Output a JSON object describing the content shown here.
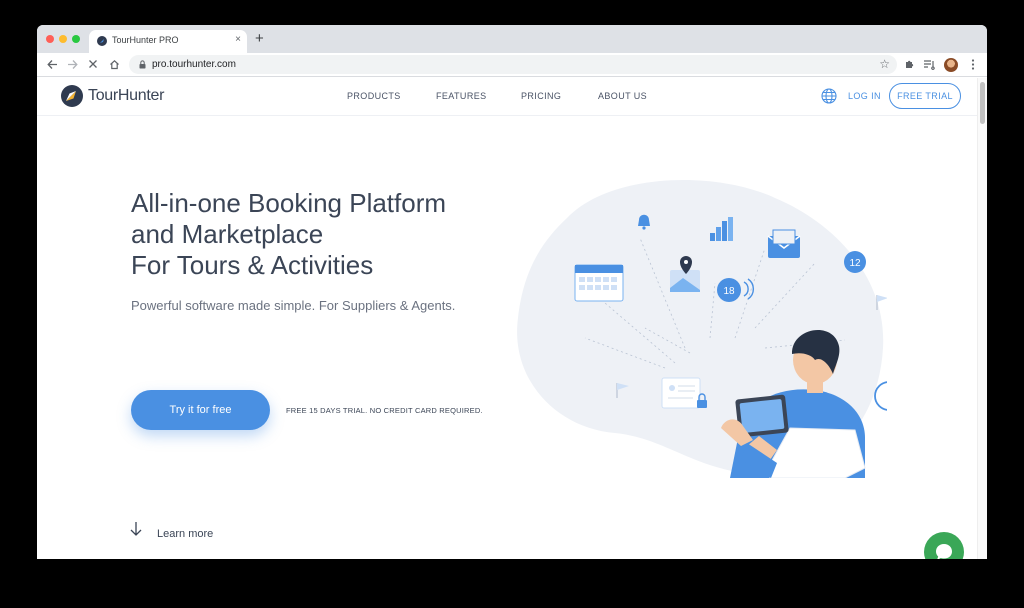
{
  "browser": {
    "tab_title": "TourHunter PRO",
    "tab_close": "×",
    "new_tab": "+",
    "url": "pro.tourhunter.com"
  },
  "nav": {
    "logo_text": "TourHunter",
    "links": [
      "PRODUCTS",
      "FEATURES",
      "PRICING",
      "ABOUT US"
    ],
    "login": "LOG IN",
    "free_trial": "FREE TRIAL"
  },
  "hero": {
    "title_lines": [
      "All-in-one Booking Platform",
      "and Marketplace",
      "For Tours & Activities"
    ],
    "subtitle": "Powerful software made simple. For Suppliers & Agents.",
    "cta_label": "Try it for free",
    "cta_note": "FREE 15 DAYS TRIAL. NO CREDIT CARD REQUIRED."
  },
  "illustration": {
    "badge_1": "18",
    "badge_2": "12"
  },
  "learn_more": "Learn more",
  "colors": {
    "accent": "#4a90e2",
    "chat": "#3aa757",
    "text_dark": "#3b4556"
  }
}
